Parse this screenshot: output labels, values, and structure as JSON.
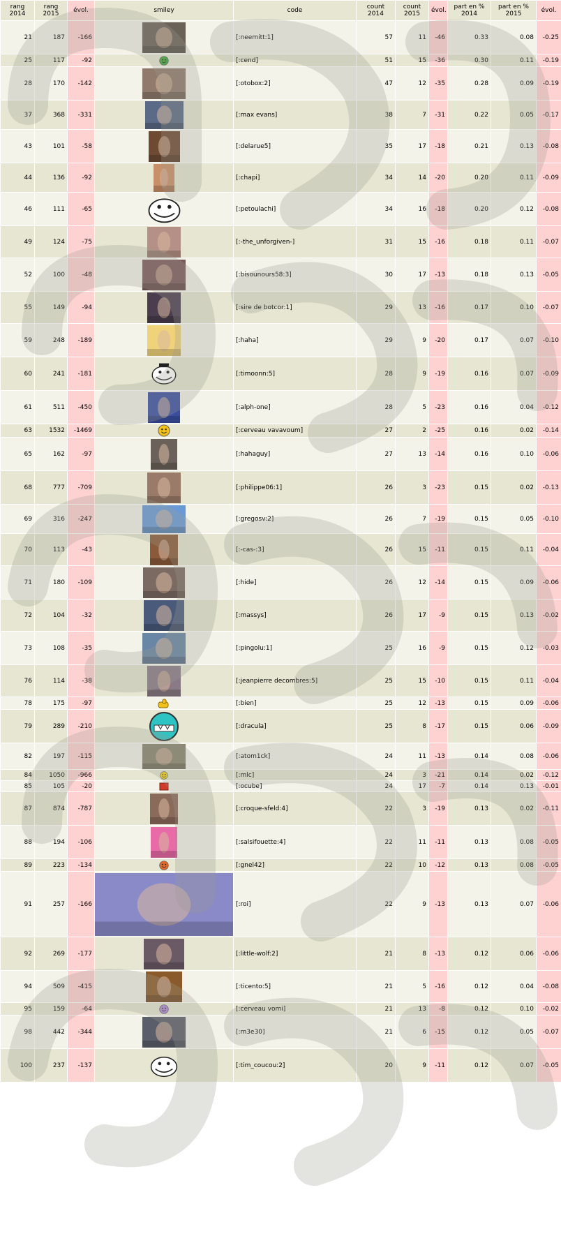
{
  "headers": {
    "rang2014": "rang 2014",
    "rang2015": "rang 2015",
    "evol1": "évol.",
    "smiley": "smiley",
    "code": "code",
    "count2014": "count 2014",
    "count2015": "count 2015",
    "evol2": "évol.",
    "part2014": "part en % 2014",
    "part2015": "part en % 2015",
    "evol3": "évol."
  },
  "rows": [
    {
      "r14": "21",
      "r15": "187",
      "e1": "-166",
      "code": "[:neemitt:1]",
      "c14": "57",
      "c15": "11",
      "e2": "-46",
      "p14": "0.33",
      "p15": "0.08",
      "e3": "-0.25",
      "icon": "flame-photo-smiley-icon",
      "color": "#6a6258"
    },
    {
      "r14": "25",
      "r15": "117",
      "e1": "-92",
      "code": "[:cend]",
      "c14": "51",
      "c15": "15",
      "e2": "-36",
      "p14": "0.30",
      "p15": "0.11",
      "e3": "-0.19",
      "icon": "green-smile-icon",
      "color": "#3ea83a"
    },
    {
      "r14": "28",
      "r15": "170",
      "e1": "-142",
      "code": "[:otobox:2]",
      "c14": "47",
      "c15": "12",
      "e2": "-35",
      "p14": "0.28",
      "p15": "0.09",
      "e3": "-0.19",
      "icon": "portrait-photo-icon",
      "color": "#8f7a6c"
    },
    {
      "r14": "37",
      "r15": "368",
      "e1": "-331",
      "code": "[:max evans]",
      "c14": "38",
      "c15": "7",
      "e2": "-31",
      "p14": "0.22",
      "p15": "0.05",
      "e3": "-0.17",
      "icon": "portrait-photo-icon",
      "color": "#5b6a86"
    },
    {
      "r14": "43",
      "r15": "101",
      "e1": "-58",
      "code": "[:delarue5]",
      "c14": "35",
      "c15": "17",
      "e2": "-18",
      "p14": "0.21",
      "p15": "0.13",
      "e3": "-0.08",
      "icon": "portrait-photo-icon",
      "color": "#6e4a34"
    },
    {
      "r14": "44",
      "r15": "136",
      "e1": "-92",
      "code": "[:chapi]",
      "c14": "34",
      "c15": "14",
      "e2": "-20",
      "p14": "0.20",
      "p15": "0.11",
      "e3": "-0.09",
      "icon": "portrait-photo-icon",
      "color": "#c98f68"
    },
    {
      "r14": "46",
      "r15": "111",
      "e1": "-65",
      "code": "[:petoulachi]",
      "c14": "34",
      "c15": "16",
      "e2": "-18",
      "p14": "0.20",
      "p15": "0.12",
      "e3": "-0.08",
      "icon": "trollface-icon",
      "color": "#ffffff"
    },
    {
      "r14": "49",
      "r15": "124",
      "e1": "-75",
      "code": "[:-the_unforgiven-]",
      "c14": "31",
      "c15": "15",
      "e2": "-16",
      "p14": "0.18",
      "p15": "0.11",
      "e3": "-0.07",
      "icon": "photo-icon",
      "color": "#b59086"
    },
    {
      "r14": "52",
      "r15": "100",
      "e1": "-48",
      "code": "[:bisounours58:3]",
      "c14": "30",
      "c15": "17",
      "e2": "-13",
      "p14": "0.18",
      "p15": "0.13",
      "e3": "-0.05",
      "icon": "flag-photo-icon",
      "color": "#7a5a5a"
    },
    {
      "r14": "55",
      "r15": "149",
      "e1": "-94",
      "code": "[:sire de botcor:1]",
      "c14": "29",
      "c15": "13",
      "e2": "-16",
      "p14": "0.17",
      "p15": "0.10",
      "e3": "-0.07",
      "icon": "portrait-photo-icon",
      "color": "#4a3e4e"
    },
    {
      "r14": "59",
      "r15": "248",
      "e1": "-189",
      "code": "[:haha]",
      "c14": "29",
      "c15": "9",
      "e2": "-20",
      "p14": "0.17",
      "p15": "0.07",
      "e3": "-0.10",
      "icon": "cartoon-laugh-icon",
      "color": "#f0d27a"
    },
    {
      "r14": "60",
      "r15": "241",
      "e1": "-181",
      "code": "[:timoonn:5]",
      "c14": "28",
      "c15": "9",
      "e2": "-19",
      "p14": "0.16",
      "p15": "0.07",
      "e3": "-0.09",
      "icon": "top-hat-meme-icon",
      "color": "#ffffff"
    },
    {
      "r14": "61",
      "r15": "511",
      "e1": "-450",
      "code": "[:alph-one]",
      "c14": "28",
      "c15": "5",
      "e2": "-23",
      "p14": "0.16",
      "p15": "0.04",
      "e3": "-0.12",
      "icon": "anime-girl-icon",
      "color": "#3a4ea0"
    },
    {
      "r14": "63",
      "r15": "1532",
      "e1": "-1469",
      "code": "[:cerveau vavavoum]",
      "c14": "27",
      "c15": "2",
      "e2": "-25",
      "p14": "0.16",
      "p15": "0.02",
      "e3": "-0.14",
      "icon": "crown-smiley-icon",
      "color": "#f2c21a"
    },
    {
      "r14": "65",
      "r15": "162",
      "e1": "-97",
      "code": "[:hahaguy]",
      "c14": "27",
      "c15": "13",
      "e2": "-14",
      "p14": "0.16",
      "p15": "0.10",
      "e3": "-0.06",
      "icon": "pirate-photo-icon",
      "color": "#6a625a"
    },
    {
      "r14": "68",
      "r15": "777",
      "e1": "-709",
      "code": "[:philippe06:1]",
      "c14": "26",
      "c15": "3",
      "e2": "-23",
      "p14": "0.15",
      "p15": "0.02",
      "e3": "-0.13",
      "icon": "portrait-photo-icon",
      "color": "#9a7a68"
    },
    {
      "r14": "69",
      "r15": "316",
      "e1": "-247",
      "code": "[:gregosv:2]",
      "c14": "26",
      "c15": "7",
      "e2": "-19",
      "p14": "0.15",
      "p15": "0.05",
      "e3": "-0.10",
      "icon": "cartoon-birds-icon",
      "color": "#6a9ad6"
    },
    {
      "r14": "70",
      "r15": "113",
      "e1": "-43",
      "code": "[:-cas-:3]",
      "c14": "26",
      "c15": "15",
      "e2": "-11",
      "p14": "0.15",
      "p15": "0.11",
      "e3": "-0.04",
      "icon": "portrait-photo-icon",
      "color": "#8a5a3a"
    },
    {
      "r14": "71",
      "r15": "180",
      "e1": "-109",
      "code": "[:hide]",
      "c14": "26",
      "c15": "12",
      "e2": "-14",
      "p14": "0.15",
      "p15": "0.09",
      "e3": "-0.06",
      "icon": "portrait-photo-icon",
      "color": "#7a6a62"
    },
    {
      "r14": "72",
      "r15": "104",
      "e1": "-32",
      "code": "[:massys]",
      "c14": "26",
      "c15": "17",
      "e2": "-9",
      "p14": "0.15",
      "p15": "0.13",
      "e3": "-0.02",
      "icon": "portrait-photo-icon",
      "color": "#4a5a7a"
    },
    {
      "r14": "73",
      "r15": "108",
      "e1": "-35",
      "code": "[:pingolu:1]",
      "c14": "25",
      "c15": "16",
      "e2": "-9",
      "p14": "0.15",
      "p15": "0.12",
      "e3": "-0.03",
      "icon": "sea-photo-icon",
      "color": "#6a86a6"
    },
    {
      "r14": "76",
      "r15": "114",
      "e1": "-38",
      "code": "[:jeanpierre decombres:5]",
      "c14": "25",
      "c15": "15",
      "e2": "-10",
      "p14": "0.15",
      "p15": "0.11",
      "e3": "-0.04",
      "icon": "hood-photo-icon",
      "color": "#8a7a86"
    },
    {
      "r14": "78",
      "r15": "175",
      "e1": "-97",
      "code": "[:bien]",
      "c14": "25",
      "c15": "12",
      "e2": "-13",
      "p14": "0.15",
      "p15": "0.09",
      "e3": "-0.06",
      "icon": "thumbs-up-icon",
      "color": "#f2c21a"
    },
    {
      "r14": "79",
      "r15": "289",
      "e1": "-210",
      "code": "[:dracula]",
      "c14": "25",
      "c15": "8",
      "e2": "-17",
      "p14": "0.15",
      "p15": "0.06",
      "e3": "-0.09",
      "icon": "teal-grin-icon",
      "color": "#2ec4c4"
    },
    {
      "r14": "82",
      "r15": "197",
      "e1": "-115",
      "code": "[:atom1ck]",
      "c14": "24",
      "c15": "11",
      "e2": "-13",
      "p14": "0.14",
      "p15": "0.08",
      "e3": "-0.06",
      "icon": "money-photo-icon",
      "color": "#8a8470"
    },
    {
      "r14": "84",
      "r15": "1050",
      "e1": "-966",
      "code": "[:mlc]",
      "c14": "24",
      "c15": "3",
      "e2": "-21",
      "p14": "0.14",
      "p15": "0.02",
      "e3": "-0.12",
      "icon": "yellow-smiley-icon",
      "color": "#f2d21a"
    },
    {
      "r14": "85",
      "r15": "105",
      "e1": "-20",
      "code": "[:ocube]",
      "c14": "24",
      "c15": "17",
      "e2": "-7",
      "p14": "0.14",
      "p15": "0.13",
      "e3": "-0.01",
      "icon": "red-cube-icon",
      "color": "#d23a2a"
    },
    {
      "r14": "87",
      "r15": "874",
      "e1": "-787",
      "code": "[:croque-sfeld:4]",
      "c14": "22",
      "c15": "3",
      "e2": "-19",
      "p14": "0.13",
      "p15": "0.02",
      "e3": "-0.11",
      "icon": "portrait-photo-icon",
      "color": "#8a6a5a"
    },
    {
      "r14": "88",
      "r15": "194",
      "e1": "-106",
      "code": "[:salsifouette:4]",
      "c14": "22",
      "c15": "11",
      "e2": "-11",
      "p14": "0.13",
      "p15": "0.08",
      "e3": "-0.05",
      "icon": "punk-drawing-icon",
      "color": "#e86aa6"
    },
    {
      "r14": "89",
      "r15": "223",
      "e1": "-134",
      "code": "[:gnel42]",
      "c14": "22",
      "c15": "10",
      "e2": "-12",
      "p14": "0.13",
      "p15": "0.08",
      "e3": "-0.05",
      "icon": "orange-smiley-icon",
      "color": "#e0682a"
    },
    {
      "r14": "91",
      "r15": "257",
      "e1": "-166",
      "code": "[:roi]",
      "c14": "22",
      "c15": "9",
      "e2": "-13",
      "p14": "0.13",
      "p15": "0.07",
      "e3": "-0.06",
      "icon": "king-crowd-icon",
      "color": "#8a8ac8"
    },
    {
      "r14": "92",
      "r15": "269",
      "e1": "-177",
      "code": "[:little-wolf:2]",
      "c14": "21",
      "c15": "8",
      "e2": "-13",
      "p14": "0.12",
      "p15": "0.06",
      "e3": "-0.06",
      "icon": "portrait-photo-icon",
      "color": "#6a5a66"
    },
    {
      "r14": "94",
      "r15": "509",
      "e1": "-415",
      "code": "[:ticento:5]",
      "c14": "21",
      "c15": "5",
      "e2": "-16",
      "p14": "0.12",
      "p15": "0.04",
      "e3": "-0.08",
      "icon": "dog-photo-icon",
      "color": "#8a5a2a"
    },
    {
      "r14": "95",
      "r15": "159",
      "e1": "-64",
      "code": "[:cerveau vomi]",
      "c14": "21",
      "c15": "13",
      "e2": "-8",
      "p14": "0.12",
      "p15": "0.10",
      "e3": "-0.02",
      "icon": "purple-smiley-icon",
      "color": "#b08ad6"
    },
    {
      "r14": "98",
      "r15": "442",
      "e1": "-344",
      "code": "[:m3e30]",
      "c14": "21",
      "c15": "6",
      "e2": "-15",
      "p14": "0.12",
      "p15": "0.05",
      "e3": "-0.07",
      "icon": "portrait-photo-icon",
      "color": "#5a5e6a"
    },
    {
      "r14": "100",
      "r15": "237",
      "e1": "-137",
      "code": "[:tim_coucou:2]",
      "c14": "20",
      "c15": "9",
      "e2": "-11",
      "p14": "0.12",
      "p15": "0.07",
      "e3": "-0.05",
      "icon": "rage-face-icon",
      "color": "#ffffff"
    }
  ]
}
